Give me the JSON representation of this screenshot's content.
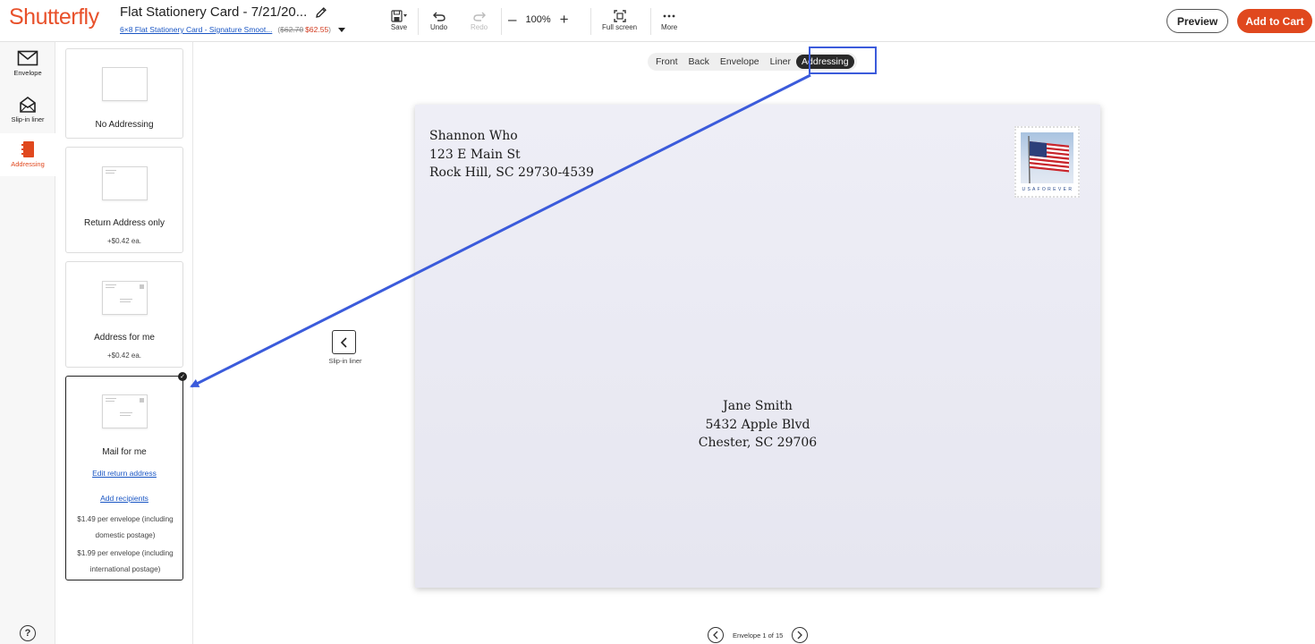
{
  "header": {
    "logo": "Shutterfly",
    "project_title": "Flat Stationery Card - 7/21/20...",
    "product_link": "6×8 Flat Stationery Card - Signature Smoot...",
    "paren_open": "(",
    "price_original": "$62.70",
    "price_sale": "$62.55",
    "paren_close": ")",
    "tools": {
      "save": "Save",
      "undo": "Undo",
      "redo": "Redo",
      "zoom_level": "100%",
      "fullscreen": "Full screen",
      "more": "More"
    },
    "preview": "Preview",
    "add_to_cart": "Add to Cart"
  },
  "rail": {
    "items": [
      {
        "label": "Envelope",
        "icon": "envelope-icon"
      },
      {
        "label": "Slip-in liner",
        "icon": "open-envelope-icon"
      },
      {
        "label": "Addressing",
        "icon": "address-book-icon",
        "active": true
      }
    ],
    "help": "?"
  },
  "options": [
    {
      "title": "No Addressing"
    },
    {
      "title": "Return Address only",
      "price": "+$0.42 ea."
    },
    {
      "title": "Address for me",
      "price": "+$0.42 ea."
    },
    {
      "title": "Mail for me",
      "selected": true,
      "link1": "Edit return address",
      "link2": "Add recipients",
      "note1a": "$1.49 per envelope (including",
      "note1b": "domestic postage)",
      "note2a": "$1.99 per envelope (including",
      "note2b": "international postage)"
    }
  ],
  "view_tabs": [
    "Front",
    "Back",
    "Envelope",
    "Liner",
    "Addressing"
  ],
  "active_tab": "Addressing",
  "envelope": {
    "return_address": [
      "Shannon Who",
      "123 E Main St",
      "Rock Hill, SC 29730-4539"
    ],
    "recipient": [
      "Jane Smith",
      "5432 Apple Blvd",
      "Chester, SC 29706"
    ],
    "stamp_text": "U S A F O R E V E R"
  },
  "nav_back_label": "Slip-in liner",
  "pager": "Envelope 1 of 15",
  "colors": {
    "brand": "#e8512b",
    "cart_button": "#e0481e",
    "link": "#1a56c4",
    "annotation": "#3b5bdb"
  }
}
